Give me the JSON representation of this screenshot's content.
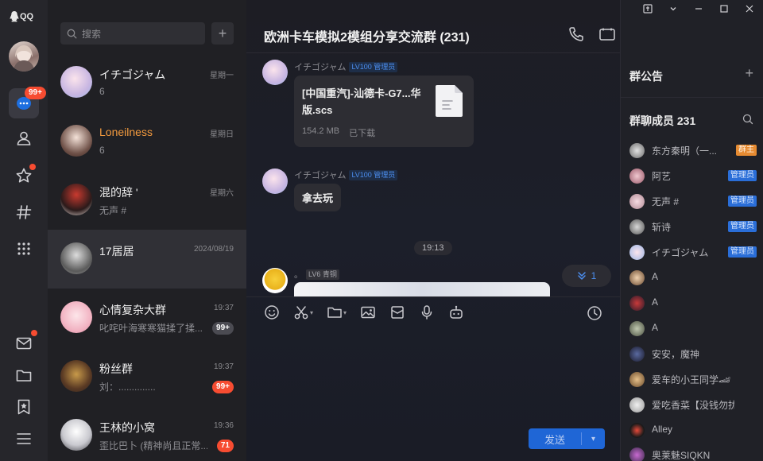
{
  "app": {
    "logo_text": "QQ"
  },
  "rail": {
    "messages_badge": "99+"
  },
  "search": {
    "placeholder": "搜索",
    "add_label": "+"
  },
  "conversations": [
    {
      "name": "イチゴジャム",
      "time": "星期一",
      "preview": "6",
      "badge": ""
    },
    {
      "name": "Loneilness",
      "time": "星期日",
      "preview": "6",
      "badge": ""
    },
    {
      "name": "混的辞 '",
      "time": "星期六",
      "preview": "无声 #",
      "badge": ""
    },
    {
      "name": "17居居",
      "time": "2024/08/19",
      "preview": "",
      "badge": ""
    },
    {
      "name": "心情复杂大群",
      "time": "19:37",
      "preview": "叱咤叶海寒寒猫揉了揉...",
      "badge": "99+"
    },
    {
      "name": "粉丝群",
      "time": "19:37",
      "preview": "刘：..............",
      "badge": "99+"
    },
    {
      "name": "王林的小窝",
      "time": "19:36",
      "preview": "歪比巴卜 (精神尚且正常...",
      "badge": "71"
    }
  ],
  "chat": {
    "title": "欧洲卡车模拟2模组分享交流群 (231)",
    "messages": [
      {
        "sender": "イチゴジャム",
        "level": "LV100 管理员",
        "file_name": "[中国重汽]-汕德卡-G7...华版.scs",
        "file_size": "154.2 MB",
        "file_status": "已下载"
      },
      {
        "sender": "イチゴジャム",
        "level": "LV100 管理员",
        "text": "拿去玩"
      },
      {
        "time": "19:13"
      },
      {
        "sender": "。",
        "level": "LV6 青铜"
      }
    ],
    "jump_count": "1",
    "send_label": "发送"
  },
  "panel": {
    "notice_title": "群公告",
    "members_title": "群聊成员 231",
    "members": [
      {
        "name": "东方秦明（一...",
        "role": "群主"
      },
      {
        "name": "阿艺",
        "role": "管理员"
      },
      {
        "name": "无声 #",
        "role": "管理员"
      },
      {
        "name": "斩诗",
        "role": "管理员"
      },
      {
        "name": "イチゴジャム",
        "role": "管理员"
      },
      {
        "name": "A",
        "role": ""
      },
      {
        "name": "A",
        "role": ""
      },
      {
        "name": "A",
        "role": ""
      },
      {
        "name": "安安，魔神",
        "role": ""
      },
      {
        "name": "爱车的小王同学🏎",
        "role": ""
      },
      {
        "name": "爱吃香菜【没钱勿扰】",
        "role": ""
      },
      {
        "name": "Alley",
        "role": ""
      },
      {
        "name": "奥莱魅SIQKN",
        "role": ""
      }
    ]
  },
  "colors": {
    "accent": "#1f66d6",
    "badge": "#f74c31",
    "owner": "#e68b32",
    "admin": "#2a6ed8",
    "highlight_name": "#f39a3e"
  }
}
